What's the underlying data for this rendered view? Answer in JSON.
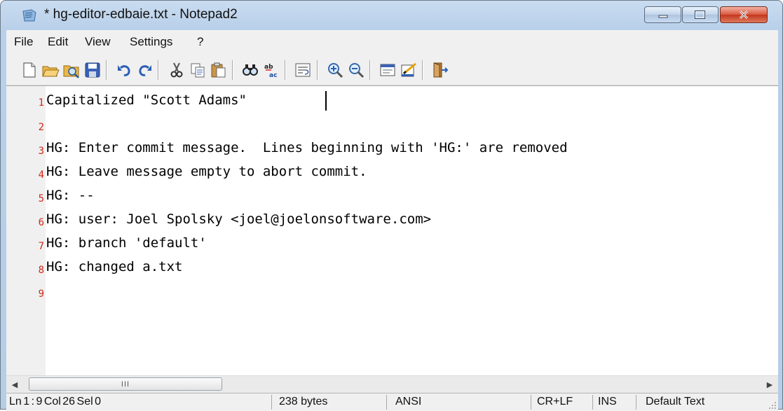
{
  "window": {
    "title": "* hg-editor-edbaie.txt - Notepad2",
    "close_color": "#c4361c"
  },
  "menu": {
    "items": [
      "File",
      "Edit",
      "View",
      "Settings",
      "?"
    ]
  },
  "toolbar": {
    "buttons": [
      "new-file-icon",
      "open-folder-icon",
      "browse-icon",
      "save-icon",
      "undo-icon",
      "redo-icon",
      "cut-icon",
      "copy-icon",
      "paste-icon",
      "find-icon",
      "replace-icon",
      "word-wrap-icon",
      "zoom-in-icon",
      "zoom-out-icon",
      "settings-icon",
      "scheme-icon",
      "exit-icon"
    ]
  },
  "editor": {
    "lines": [
      {
        "num": "1",
        "text": "Capitalized \"Scott Adams\""
      },
      {
        "num": "2",
        "text": ""
      },
      {
        "num": "3",
        "text": "HG: Enter commit message.  Lines beginning with 'HG:' are removed"
      },
      {
        "num": "4",
        "text": "HG: Leave message empty to abort commit."
      },
      {
        "num": "5",
        "text": "HG: --"
      },
      {
        "num": "6",
        "text": "HG: user: Joel Spolsky <joel@joelonsoftware.com>"
      },
      {
        "num": "7",
        "text": "HG: branch 'default'"
      },
      {
        "num": "8",
        "text": "HG: changed a.txt"
      },
      {
        "num": "9",
        "text": ""
      }
    ],
    "line_number_color": "#d0281a"
  },
  "scrollbar": {
    "grip": "III"
  },
  "status": {
    "position": "Ln 1 : 9   Col 26   Sel 0",
    "size": "238 bytes",
    "encoding": "ANSI",
    "line_endings": "CR+LF",
    "mode": "INS",
    "scheme": "Default Text"
  }
}
